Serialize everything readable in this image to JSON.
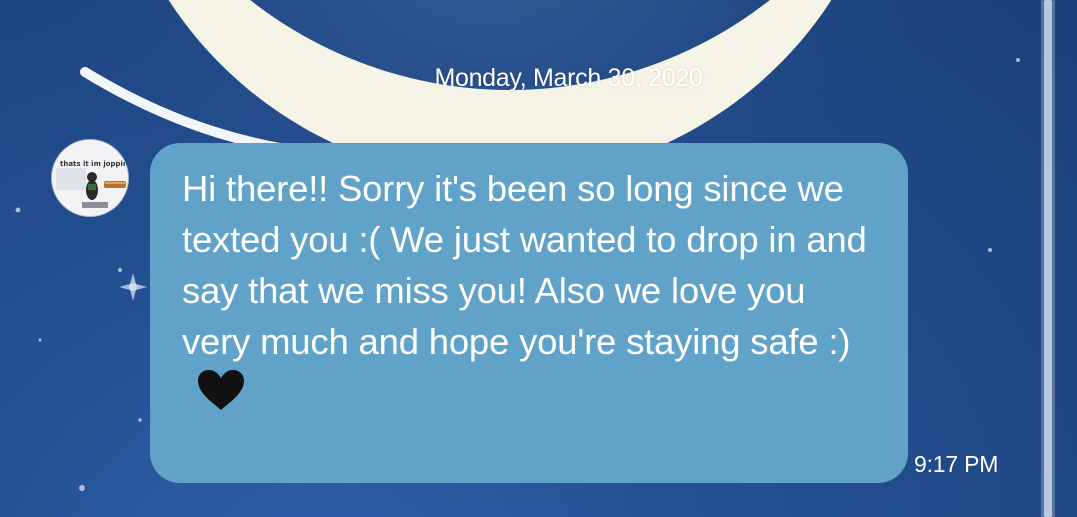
{
  "conversation": {
    "date_separator": "Monday, March 30, 2020",
    "avatar": {
      "caption": "thats it im jopping"
    },
    "message": {
      "text": "Hi there!! Sorry it's been so long since we texted you :( We just wanted to drop in and say that we miss you! Also we love you very much and hope you're staying safe :)",
      "emoji": "black-heart-icon",
      "time": "9:17 PM"
    }
  },
  "colors": {
    "background": "#22498a",
    "bubble": "#61a2c9",
    "moon": "#f6f4e6",
    "text": "#ffffff"
  }
}
